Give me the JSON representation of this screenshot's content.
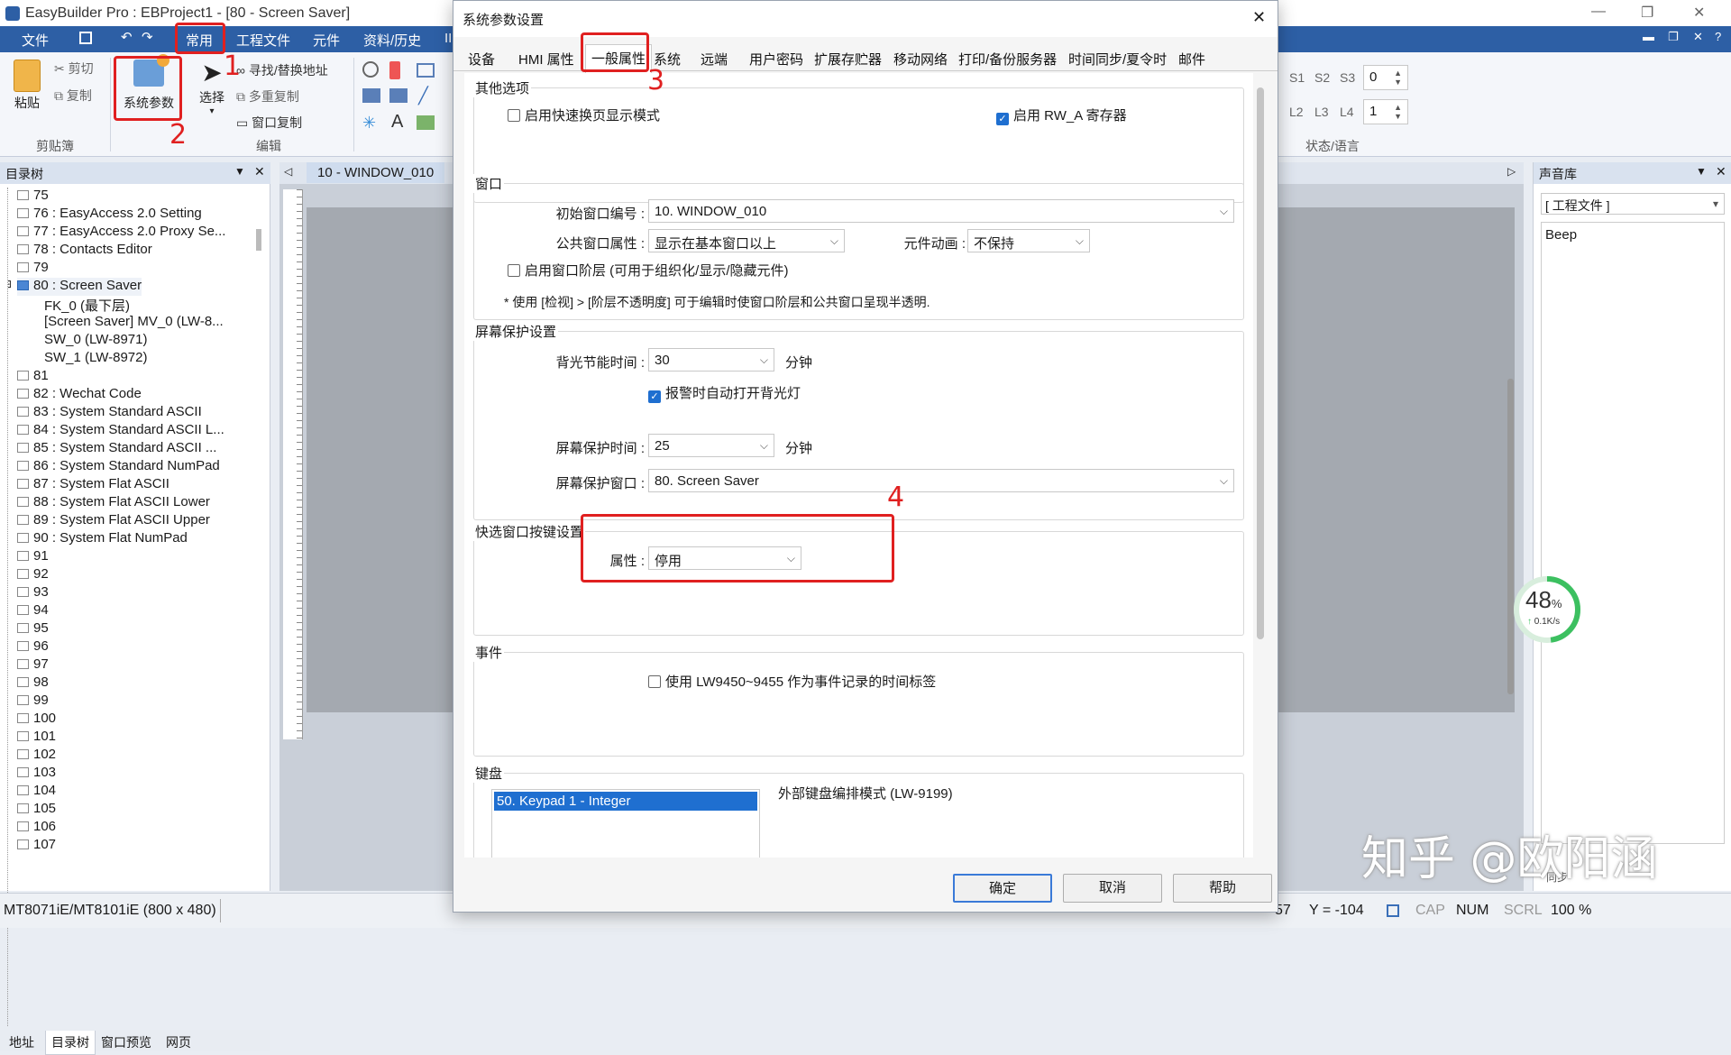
{
  "app": {
    "title": "EasyBuilder Pro : EBProject1 - [80 - Screen Saver]",
    "ribbon_tabs": [
      "文件",
      "常用",
      "工程文件",
      "元件",
      "资料/历史",
      "IIo"
    ],
    "ribbon": {
      "paste": "粘贴",
      "cut": "剪切",
      "copy": "复制",
      "clipboard_group": "剪贴簿",
      "sysparam": "系统参数",
      "select": "选择",
      "find_replace": "寻找/替换地址",
      "multi_copy": "多重复制",
      "window_copy": "窗口复制",
      "edit_group": "编辑",
      "s_labels": [
        "S1",
        "S2",
        "S3"
      ],
      "s_value": "0",
      "l_labels": [
        "L2",
        "L3",
        "L4"
      ],
      "l_value": "1",
      "status_group": "状态/语言"
    },
    "accent": "#2d5fa5",
    "highlight": "#e02020"
  },
  "annotations": [
    "1",
    "2",
    "3",
    "4"
  ],
  "tree": {
    "title": "目录树",
    "items": [
      {
        "label": "75",
        "sel": false,
        "indent": 0
      },
      {
        "label": "76 : EasyAccess 2.0 Setting",
        "sel": false,
        "indent": 0
      },
      {
        "label": "77 : EasyAccess 2.0 Proxy Se...",
        "sel": false,
        "indent": 0
      },
      {
        "label": "78 : Contacts Editor",
        "sel": false,
        "indent": 0
      },
      {
        "label": "79",
        "sel": false,
        "indent": 0
      },
      {
        "label": "80 : Screen Saver",
        "sel": true,
        "indent": 0
      },
      {
        "label": "FK_0 (最下层)",
        "sel": false,
        "indent": 1
      },
      {
        "label": "[Screen Saver] MV_0 (LW-8...",
        "sel": false,
        "indent": 1
      },
      {
        "label": "SW_0 (LW-8971)",
        "sel": false,
        "indent": 1
      },
      {
        "label": "SW_1 (LW-8972)",
        "sel": false,
        "indent": 1
      },
      {
        "label": "81",
        "sel": false,
        "indent": 0
      },
      {
        "label": "82 : Wechat Code",
        "sel": false,
        "indent": 0
      },
      {
        "label": "83 : System Standard ASCII",
        "sel": false,
        "indent": 0
      },
      {
        "label": "84 : System Standard ASCII L...",
        "sel": false,
        "indent": 0
      },
      {
        "label": "85 : System Standard ASCII ...",
        "sel": false,
        "indent": 0
      },
      {
        "label": "86 : System Standard NumPad",
        "sel": false,
        "indent": 0
      },
      {
        "label": "87 : System Flat ASCII",
        "sel": false,
        "indent": 0
      },
      {
        "label": "88 : System Flat ASCII Lower",
        "sel": false,
        "indent": 0
      },
      {
        "label": "89 : System Flat ASCII Upper",
        "sel": false,
        "indent": 0
      },
      {
        "label": "90 : System Flat NumPad",
        "sel": false,
        "indent": 0
      },
      {
        "label": "91",
        "sel": false,
        "indent": 0
      },
      {
        "label": "92",
        "sel": false,
        "indent": 0
      },
      {
        "label": "93",
        "sel": false,
        "indent": 0
      },
      {
        "label": "94",
        "sel": false,
        "indent": 0
      },
      {
        "label": "95",
        "sel": false,
        "indent": 0
      },
      {
        "label": "96",
        "sel": false,
        "indent": 0
      },
      {
        "label": "97",
        "sel": false,
        "indent": 0
      },
      {
        "label": "98",
        "sel": false,
        "indent": 0
      },
      {
        "label": "99",
        "sel": false,
        "indent": 0
      },
      {
        "label": "100",
        "sel": false,
        "indent": 0
      },
      {
        "label": "101",
        "sel": false,
        "indent": 0
      },
      {
        "label": "102",
        "sel": false,
        "indent": 0
      },
      {
        "label": "103",
        "sel": false,
        "indent": 0
      },
      {
        "label": "104",
        "sel": false,
        "indent": 0
      },
      {
        "label": "105",
        "sel": false,
        "indent": 0
      },
      {
        "label": "106",
        "sel": false,
        "indent": 0
      },
      {
        "label": "107",
        "sel": false,
        "indent": 0
      }
    ],
    "bottom_tabs": [
      "地址",
      "目录树",
      "窗口预览",
      "网页"
    ]
  },
  "canvas": {
    "tab": "10 - WINDOW_010"
  },
  "sound": {
    "title": "声音库",
    "filter": "[ 工程文件 ]",
    "items": [
      "Beep"
    ],
    "bottom": "同步"
  },
  "speed": {
    "percent": "48",
    "unit": "%",
    "rate": "0.1K/s"
  },
  "status": {
    "model": "MT8071iE/MT8101iE (800 x 480)",
    "x_tail": "57",
    "y": "Y = -104",
    "cap": "CAP",
    "num": "NUM",
    "scrl": "SCRL",
    "zoom": "100 %"
  },
  "watermark": "知乎 @欧阳涵",
  "dialog": {
    "title": "系统参数设置",
    "tabs": [
      "设备",
      "HMI 属性",
      "一般属性",
      "系统",
      "远端",
      "用户密码",
      "扩展存贮器",
      "移动网络",
      "打印/备份服务器",
      "时间同步/夏令时",
      "邮件"
    ],
    "other": {
      "title": "其他选项",
      "fast_switch": "启用快速换页显示模式",
      "fast_switch_on": false,
      "rw_a": "启用 RW_A 寄存器",
      "rw_a_on": true
    },
    "window": {
      "title": "窗口",
      "init_label": "初始窗口编号 :",
      "init_value": "10. WINDOW_010",
      "common_label": "公共窗口属性 :",
      "common_value": "显示在基本窗口以上",
      "anim_label": "元件动画 :",
      "anim_value": "不保持",
      "layer": "启用窗口阶层 (可用于组织化/显示/隐藏元件)",
      "layer_on": false,
      "note": "* 使用 [检视] > [阶层不透明度] 可于编辑时使窗口阶层和公共窗口呈现半透明."
    },
    "saver": {
      "title": "屏幕保护设置",
      "backlight_label": "背光节能时间 :",
      "backlight_value": "30",
      "minutes": "分钟",
      "alarm": "报警时自动打开背光灯",
      "alarm_on": true,
      "saver_time_label": "屏幕保护时间 :",
      "saver_time_value": "25",
      "saver_win_label": "屏幕保护窗口 :",
      "saver_win_value": "80. Screen Saver"
    },
    "quick": {
      "title": "快选窗口按键设置",
      "attr_label": "属性 :",
      "attr_value": "停用"
    },
    "event": {
      "title": "事件",
      "lw": "使用 LW9450~9455 作为事件记录的时间标签",
      "lw_on": false
    },
    "keyboard": {
      "title": "键盘",
      "item": "50. Keypad 1 - Integer",
      "ext": "外部键盘编排模式 (LW-9199)"
    },
    "buttons": {
      "ok": "确定",
      "cancel": "取消",
      "help": "帮助"
    }
  }
}
